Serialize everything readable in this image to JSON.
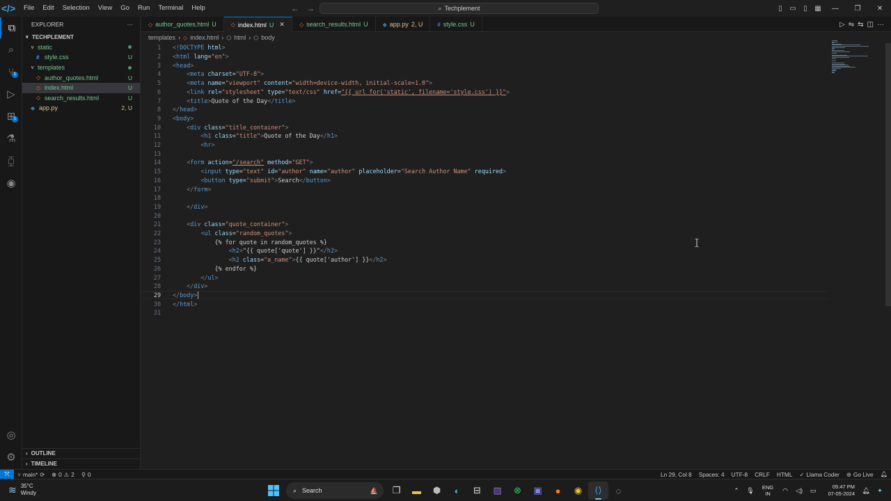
{
  "menu": [
    "File",
    "Edit",
    "Selection",
    "View",
    "Go",
    "Run",
    "Terminal",
    "Help"
  ],
  "command_center": "Techplement",
  "explorer": {
    "title": "EXPLORER",
    "more": "···",
    "root": "TECHPLEMENT",
    "items": [
      {
        "name": "static",
        "type": "folder",
        "depth": 1,
        "status": "dot",
        "color": "#73c991"
      },
      {
        "name": "style.css",
        "type": "css",
        "depth": 2,
        "status": "U",
        "color": "#73c991"
      },
      {
        "name": "templates",
        "type": "folder",
        "depth": 1,
        "status": "dot",
        "color": "#73c991"
      },
      {
        "name": "author_quotes.html",
        "type": "html",
        "depth": 2,
        "status": "U",
        "color": "#73c991"
      },
      {
        "name": "index.html",
        "type": "html",
        "depth": 2,
        "status": "U",
        "color": "#73c991",
        "selected": true
      },
      {
        "name": "search_results.html",
        "type": "html",
        "depth": 2,
        "status": "U",
        "color": "#73c991"
      },
      {
        "name": "app.py",
        "type": "py",
        "depth": 1,
        "status": "2, U",
        "color": "#e2c08d"
      }
    ],
    "outline": "OUTLINE",
    "timeline": "TIMELINE"
  },
  "tabs": [
    {
      "label": "author_quotes.html",
      "status": "U",
      "icon": "html",
      "active": false
    },
    {
      "label": "index.html",
      "status": "U",
      "icon": "html",
      "active": true
    },
    {
      "label": "search_results.html",
      "status": "U",
      "icon": "html",
      "active": false
    },
    {
      "label": "app.py",
      "status": "2, U",
      "icon": "py",
      "active": false
    },
    {
      "label": "style.css",
      "status": "U",
      "icon": "css",
      "active": false
    }
  ],
  "breadcrumb": [
    "templates",
    "index.html",
    "html",
    "body"
  ],
  "code_lines": [
    [
      [
        "t",
        "<!"
      ],
      [
        "k",
        "DOCTYPE"
      ],
      [
        "a",
        " html"
      ],
      [
        "t",
        ">"
      ]
    ],
    [
      [
        "t",
        "<"
      ],
      [
        "k",
        "html"
      ],
      [
        "a",
        " lang"
      ],
      [
        "p",
        "="
      ],
      [
        "s",
        "\"en\""
      ],
      [
        "t",
        ">"
      ]
    ],
    [
      [
        "t",
        "<"
      ],
      [
        "k",
        "head"
      ],
      [
        "t",
        ">"
      ]
    ],
    [
      [
        "p",
        "    "
      ],
      [
        "t",
        "<"
      ],
      [
        "k",
        "meta"
      ],
      [
        "a",
        " charset"
      ],
      [
        "p",
        "="
      ],
      [
        "s",
        "\"UTF-8\""
      ],
      [
        "t",
        ">"
      ]
    ],
    [
      [
        "p",
        "    "
      ],
      [
        "t",
        "<"
      ],
      [
        "k",
        "meta"
      ],
      [
        "a",
        " name"
      ],
      [
        "p",
        "="
      ],
      [
        "s",
        "\"viewport\""
      ],
      [
        "a",
        " content"
      ],
      [
        "p",
        "="
      ],
      [
        "s",
        "\"width=device-width, initial-scale=1.0\""
      ],
      [
        "t",
        ">"
      ]
    ],
    [
      [
        "p",
        "    "
      ],
      [
        "t",
        "<"
      ],
      [
        "k",
        "link"
      ],
      [
        "a",
        " rel"
      ],
      [
        "p",
        "="
      ],
      [
        "s",
        "\"stylesheet\""
      ],
      [
        "a",
        " type"
      ],
      [
        "p",
        "="
      ],
      [
        "s",
        "\"text/css\""
      ],
      [
        "a",
        " href"
      ],
      [
        "p",
        "="
      ],
      [
        "u",
        "\"{{ url_for('static', filename='style.css') }}\""
      ],
      [
        "t",
        ">"
      ]
    ],
    [
      [
        "p",
        "    "
      ],
      [
        "t",
        "<"
      ],
      [
        "k",
        "title"
      ],
      [
        "t",
        ">"
      ],
      [
        "p",
        "Quote of the Day"
      ],
      [
        "t",
        "</"
      ],
      [
        "k",
        "title"
      ],
      [
        "t",
        ">"
      ]
    ],
    [
      [
        "t",
        "</"
      ],
      [
        "k",
        "head"
      ],
      [
        "t",
        ">"
      ]
    ],
    [
      [
        "t",
        "<"
      ],
      [
        "k",
        "body"
      ],
      [
        "t",
        ">"
      ]
    ],
    [
      [
        "p",
        "    "
      ],
      [
        "t",
        "<"
      ],
      [
        "k",
        "div"
      ],
      [
        "a",
        " class"
      ],
      [
        "p",
        "="
      ],
      [
        "s",
        "\"title_container\""
      ],
      [
        "t",
        ">"
      ]
    ],
    [
      [
        "p",
        "        "
      ],
      [
        "t",
        "<"
      ],
      [
        "k",
        "h1"
      ],
      [
        "a",
        " class"
      ],
      [
        "p",
        "="
      ],
      [
        "s",
        "\"title\""
      ],
      [
        "t",
        ">"
      ],
      [
        "p",
        "Quote of the Day"
      ],
      [
        "t",
        "</"
      ],
      [
        "k",
        "h1"
      ],
      [
        "t",
        ">"
      ]
    ],
    [
      [
        "p",
        "        "
      ],
      [
        "t",
        "<"
      ],
      [
        "k",
        "hr"
      ],
      [
        "t",
        ">"
      ]
    ],
    [],
    [
      [
        "p",
        "    "
      ],
      [
        "t",
        "<"
      ],
      [
        "k",
        "form"
      ],
      [
        "a",
        " action"
      ],
      [
        "p",
        "="
      ],
      [
        "u",
        "\"/search\""
      ],
      [
        "a",
        " method"
      ],
      [
        "p",
        "="
      ],
      [
        "s",
        "\"GET\""
      ],
      [
        "t",
        ">"
      ]
    ],
    [
      [
        "p",
        "        "
      ],
      [
        "t",
        "<"
      ],
      [
        "k",
        "input"
      ],
      [
        "a",
        " type"
      ],
      [
        "p",
        "="
      ],
      [
        "s",
        "\"text\""
      ],
      [
        "a",
        " id"
      ],
      [
        "p",
        "="
      ],
      [
        "s",
        "\"author\""
      ],
      [
        "a",
        " name"
      ],
      [
        "p",
        "="
      ],
      [
        "s",
        "\"author\""
      ],
      [
        "a",
        " placeholder"
      ],
      [
        "p",
        "="
      ],
      [
        "s",
        "\"Search Author Name\""
      ],
      [
        "a",
        " required"
      ],
      [
        "t",
        ">"
      ]
    ],
    [
      [
        "p",
        "        "
      ],
      [
        "t",
        "<"
      ],
      [
        "k",
        "button"
      ],
      [
        "a",
        " type"
      ],
      [
        "p",
        "="
      ],
      [
        "s",
        "\"submit\""
      ],
      [
        "t",
        ">"
      ],
      [
        "p",
        "Search"
      ],
      [
        "t",
        "</"
      ],
      [
        "k",
        "button"
      ],
      [
        "t",
        ">"
      ]
    ],
    [
      [
        "p",
        "    "
      ],
      [
        "t",
        "</"
      ],
      [
        "k",
        "form"
      ],
      [
        "t",
        ">"
      ]
    ],
    [],
    [
      [
        "p",
        "    "
      ],
      [
        "t",
        "</"
      ],
      [
        "k",
        "div"
      ],
      [
        "t",
        ">"
      ]
    ],
    [],
    [
      [
        "p",
        "    "
      ],
      [
        "t",
        "<"
      ],
      [
        "k",
        "div"
      ],
      [
        "a",
        " class"
      ],
      [
        "p",
        "="
      ],
      [
        "s",
        "\"quote_container\""
      ],
      [
        "t",
        ">"
      ]
    ],
    [
      [
        "p",
        "        "
      ],
      [
        "t",
        "<"
      ],
      [
        "k",
        "ul"
      ],
      [
        "a",
        " class"
      ],
      [
        "p",
        "="
      ],
      [
        "s",
        "\"random_quotes\""
      ],
      [
        "t",
        ">"
      ]
    ],
    [
      [
        "p",
        "            {% for quote in random_quotes %}"
      ]
    ],
    [
      [
        "p",
        "                "
      ],
      [
        "t",
        "<"
      ],
      [
        "k",
        "h2"
      ],
      [
        "t",
        ">"
      ],
      [
        "p",
        "\"{{ quote['quote'] }}\""
      ],
      [
        "t",
        "</"
      ],
      [
        "k",
        "h2"
      ],
      [
        "t",
        ">"
      ]
    ],
    [
      [
        "p",
        "                "
      ],
      [
        "t",
        "<"
      ],
      [
        "k",
        "h2"
      ],
      [
        "a",
        " class"
      ],
      [
        "p",
        "="
      ],
      [
        "s",
        "\"a_name\""
      ],
      [
        "t",
        ">"
      ],
      [
        "p",
        "{{ quote['author'] }}"
      ],
      [
        "t",
        "</"
      ],
      [
        "k",
        "h2"
      ],
      [
        "t",
        ">"
      ]
    ],
    [
      [
        "p",
        "            {% endfor %}"
      ]
    ],
    [
      [
        "p",
        "        "
      ],
      [
        "t",
        "</"
      ],
      [
        "k",
        "ul"
      ],
      [
        "t",
        ">"
      ]
    ],
    [
      [
        "p",
        "    "
      ],
      [
        "t",
        "</"
      ],
      [
        "k",
        "div"
      ],
      [
        "t",
        ">"
      ]
    ],
    [
      [
        "t",
        "</"
      ],
      [
        "k",
        "body"
      ],
      [
        "t",
        ">"
      ]
    ],
    [
      [
        "t",
        "</"
      ],
      [
        "k",
        "html"
      ],
      [
        "t",
        ">"
      ]
    ],
    []
  ],
  "current_line": 29,
  "syntax_colors": {
    "t": "#808080",
    "k": "#569cd6",
    "a": "#9cdcfe",
    "s": "#ce9178",
    "u": "#ce9178",
    "p": "#cccccc"
  },
  "status": {
    "branch": "main*",
    "errors": "0",
    "warnings": "2",
    "ports": "0",
    "position": "Ln 29, Col 8",
    "spaces": "Spaces: 4",
    "encoding": "UTF-8",
    "eol": "CRLF",
    "language": "HTML",
    "extension": "Llama Coder",
    "golive": "Go Live"
  },
  "taskbar": {
    "temp": "35°C",
    "weather": "Windy",
    "search_label": "Search",
    "lang1": "ENG",
    "lang2": "IN",
    "time": "05:47 PM",
    "date": "07-05-2024"
  }
}
